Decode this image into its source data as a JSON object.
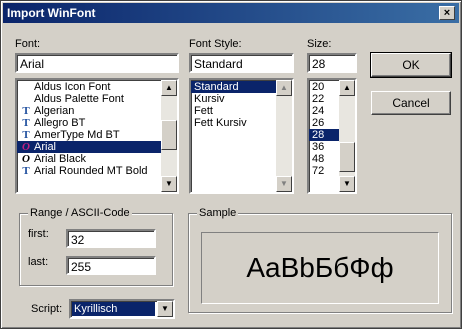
{
  "window": {
    "title": "Import WinFont",
    "close_glyph": "×"
  },
  "font": {
    "label": "Font:",
    "value": "Arial",
    "items": [
      {
        "label": "Aldus Icon Font",
        "icon": ""
      },
      {
        "label": "Aldus Palette Font",
        "icon": ""
      },
      {
        "label": "Algerian",
        "icon": "truetype-icon"
      },
      {
        "label": "Allegro BT",
        "icon": "truetype-icon"
      },
      {
        "label": "AmerType Md BT",
        "icon": "truetype-icon"
      },
      {
        "label": "Arial",
        "icon": "opentype-icon",
        "selected": true
      },
      {
        "label": "Arial Black",
        "icon": "opentype-icon"
      },
      {
        "label": "Arial Rounded MT Bold",
        "icon": "truetype-icon"
      }
    ]
  },
  "style": {
    "label": "Font Style:",
    "value": "Standard",
    "items": [
      {
        "label": "Standard",
        "selected": true
      },
      {
        "label": "Kursiv"
      },
      {
        "label": "Fett"
      },
      {
        "label": "Fett Kursiv"
      }
    ]
  },
  "size": {
    "label": "Size:",
    "value": "28",
    "items": [
      {
        "label": "20"
      },
      {
        "label": "22"
      },
      {
        "label": "24"
      },
      {
        "label": "26"
      },
      {
        "label": "28",
        "selected": true
      },
      {
        "label": "36"
      },
      {
        "label": "48"
      },
      {
        "label": "72"
      }
    ]
  },
  "buttons": {
    "ok": "OK",
    "cancel": "Cancel"
  },
  "range": {
    "title": "Range / ASCII-Code",
    "first_label": "first:",
    "first_value": "32",
    "last_label": "last:",
    "last_value": "255"
  },
  "sample": {
    "title": "Sample",
    "text": "AaBbБбФф"
  },
  "script": {
    "label": "Script:",
    "value": "Kyrillisch"
  },
  "icons": {
    "truetype": "T",
    "opentype": "O",
    "up": "▲",
    "down": "▼"
  }
}
